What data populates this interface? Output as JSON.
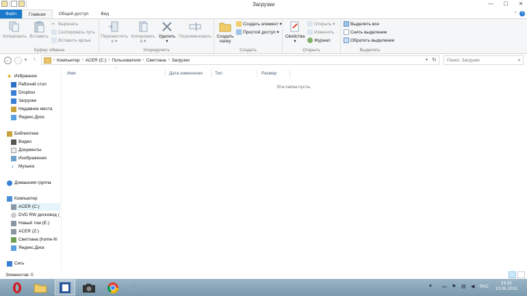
{
  "window": {
    "title": "Загрузки"
  },
  "tabs": [
    {
      "label": "Файл"
    },
    {
      "label": "Главная"
    },
    {
      "label": "Общий доступ"
    },
    {
      "label": "Вид"
    }
  ],
  "ribbon": {
    "clipboard": {
      "label": "Буфер обмена",
      "copy": "Копировать",
      "paste": "Вставить",
      "cut": "Вырезать",
      "copy_path": "Скопировать путь",
      "paste_shortcut": "Вставить ярлык"
    },
    "organize": {
      "label": "Упорядочить",
      "move_to": "Переместить",
      "copy_to": "Копировать",
      "to_suffix": "в ▾",
      "delete": "Удалить",
      "rename": "Переименовать"
    },
    "create": {
      "label": "Создать",
      "new_folder_1": "Создать",
      "new_folder_2": "папку",
      "new_item": "Создать элемент ▾",
      "easy_access": "Простой доступ ▾"
    },
    "open": {
      "label": "Открыть",
      "properties": "Свойства",
      "open": "Открыть ▾",
      "edit": "Изменить",
      "history": "Журнал"
    },
    "select": {
      "label": "Выделить",
      "select_all": "Выделить все",
      "select_none": "Снять выделение",
      "invert": "Обратить выделение"
    }
  },
  "address": {
    "crumbs": [
      "Компьютер",
      "ACER (C:)",
      "Пользователи",
      "Светлана",
      "Загрузки"
    ],
    "search_placeholder": "Поиск: Загрузки"
  },
  "nav": {
    "favorites": "Избранное",
    "desktop": "Рабочий стол",
    "dropbox": "Dropbox",
    "downloads": "Загрузки",
    "recent": "Недавние места",
    "yadisk1": "Яндекс.Диск",
    "libraries": "Библиотеки",
    "video": "Видео",
    "documents": "Документы",
    "images": "Изображения",
    "music": "Музыка",
    "homegroup": "Домашняя группа",
    "computer": "Компьютер",
    "acer_c": "ACER (C:)",
    "dvd": "DVD RW дисковод (",
    "new_volume": "Новый том (E:)",
    "acer_z": "ACER (Z:)",
    "svetlana": "Светлана (home-fri",
    "yadisk2": "Яндекс.Диск",
    "network": "Сеть"
  },
  "columns": {
    "name": "Имя",
    "modified": "Дата изменения",
    "type": "Тип",
    "size": "Размер"
  },
  "content": {
    "empty_message": "Эта папка пуста."
  },
  "status": {
    "items": "Элементов: 0"
  },
  "taskbar": {
    "lang": "РУС",
    "time": "23:32",
    "date": "13.06.2015"
  }
}
